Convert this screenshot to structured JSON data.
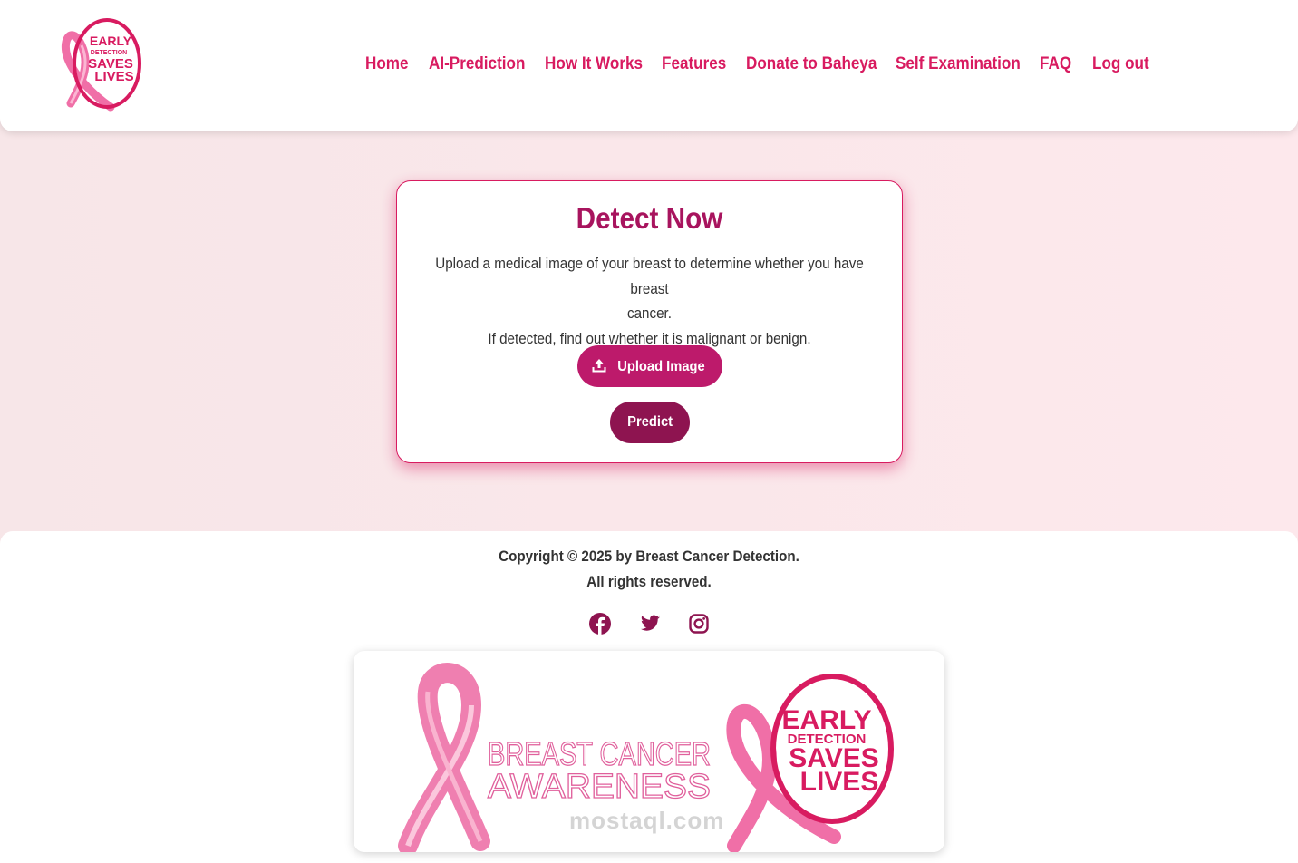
{
  "nav": {
    "items": [
      {
        "label": "Home"
      },
      {
        "label": "AI-Prediction"
      },
      {
        "label": "How It Works"
      },
      {
        "label": "Features"
      },
      {
        "label": "Donate to Baheya"
      },
      {
        "label": "Self Examination"
      },
      {
        "label": "FAQ"
      },
      {
        "label": "Log out"
      }
    ]
  },
  "logo": {
    "line1": "EARLY",
    "line2": "DETECTION",
    "line3": "SAVES",
    "line4": "LIVES",
    "icon": "pink-ribbon-icon"
  },
  "detect": {
    "title": "Detect Now",
    "desc_line1": "Upload a medical image of your breast to determine whether you have breast",
    "desc_line2": "cancer.",
    "desc_line3": "If detected, find out whether it is malignant or benign.",
    "upload_label": "Upload Image",
    "upload_icon": "upload-icon",
    "predict_label": "Predict"
  },
  "footer": {
    "copyright_line1": "Copyright © 2025 by Breast Cancer Detection.",
    "copyright_line2": "All rights reserved.",
    "social": [
      "facebook-icon",
      "twitter-icon",
      "instagram-icon"
    ]
  },
  "banner": {
    "awareness_line1": "BREAST CANCER",
    "awareness_line2": "AWARENESS",
    "badge_line1": "EARLY",
    "badge_line2": "DETECTION",
    "badge_line3": "SAVES",
    "badge_line4": "LIVES"
  },
  "watermark": "mostaql.com",
  "colors": {
    "accent": "#d81b60",
    "title": "#a8145e",
    "upload_button": "#bd1a6b",
    "predict_button": "#8e1450",
    "social": "#8e1450"
  }
}
